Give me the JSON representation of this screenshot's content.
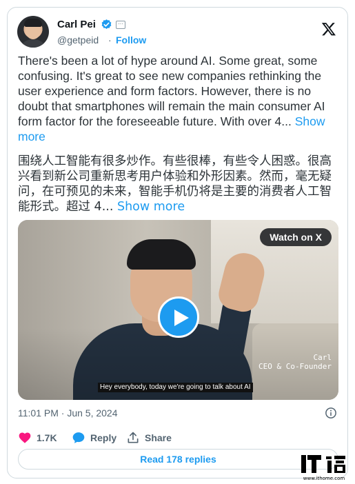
{
  "author": {
    "name": "Carl Pei",
    "handle": "@getpeid",
    "follow_label": "Follow",
    "separator": "·"
  },
  "tweet": {
    "text_en": "There's been a lot of hype around AI. Some great, some confusing. It's great to see new companies rethinking the user experience and form factors. However, there is no doubt that smartphones will remain the main consumer AI form factor for the foreseeable future. With over 4...",
    "show_more_en": "Show more",
    "text_zh": "围绕人工智能有很多炒作。有些很棒，有些令人困惑。很高兴看到新公司重新思考用户体验和外形因素。然而，毫无疑问，在可预见的未来，智能手机仍将是主要的消费者人工智能形式。超过 4...",
    "show_more_zh": "Show more"
  },
  "video": {
    "watch_label": "Watch on X",
    "overlay_name": "Carl",
    "overlay_title": "CEO & Co-Founder",
    "caption": "Hey everybody, today we're going to talk about AI"
  },
  "timestamp": "11:01 PM · Jun 5, 2024",
  "actions": {
    "like_count": "1.7K",
    "reply_label": "Reply",
    "share_label": "Share"
  },
  "read_replies_label": "Read 178 replies",
  "watermark": {
    "site": "www.ithome.com"
  },
  "colors": {
    "accent": "#1d9bf0",
    "like": "#f91880",
    "muted": "#536471"
  }
}
